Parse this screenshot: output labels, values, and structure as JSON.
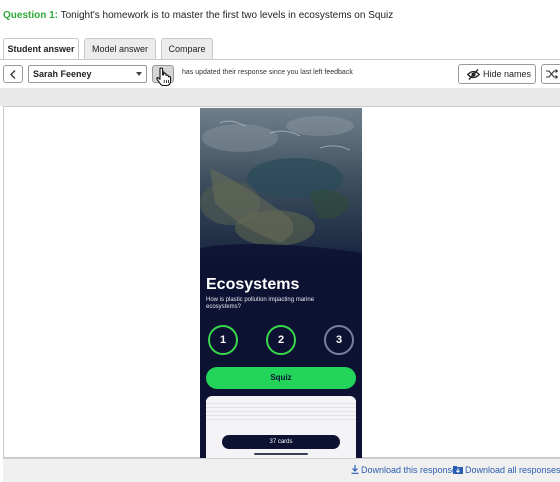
{
  "question": {
    "label": "Question 1:",
    "text": "Tonight's homework is to master the first two levels in ecosystems on Squiz"
  },
  "tabs": [
    "Student answer",
    "Model answer",
    "Compare"
  ],
  "toolbar": {
    "student_name": "Sarah Feeney",
    "status_text": "has updated their response since you last left feedback",
    "hide_names_label": "Hide names",
    "icons": [
      "chevron-left-icon",
      "chevron-right-icon",
      "pointer-hand-icon",
      "eye-slash-icon",
      "shuffle-icon"
    ]
  },
  "response": {
    "title": "Ecosystems",
    "subtitle": "How is plastic pollution impacting marine ecosystems?",
    "levels": [
      "1",
      "2",
      "3"
    ],
    "play_label": "Squiz",
    "cards_label": "37 cards"
  },
  "footer": {
    "download_response": "Download this response",
    "download_all": "Download all responses"
  },
  "colors": {
    "question_label": "#2eaa3a",
    "level_active": "#3ad64e",
    "level_locked": "#7c7f9a",
    "play_button": "#22d45a",
    "phone_background": "#0d1233",
    "link": "#2a5db0"
  }
}
